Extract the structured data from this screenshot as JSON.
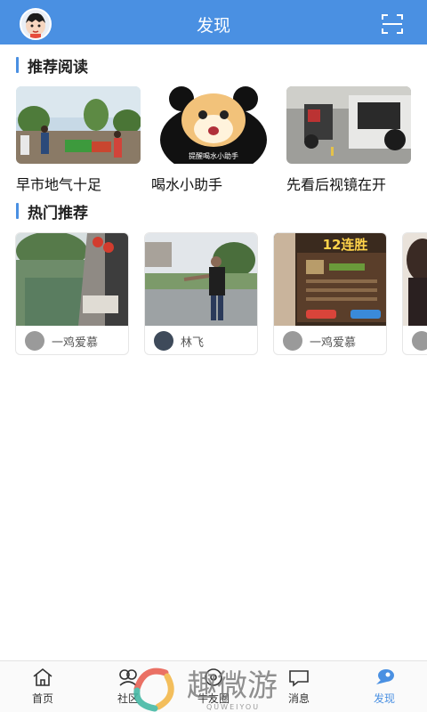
{
  "header": {
    "title": "发现"
  },
  "sections": {
    "recommended": {
      "title": "推荐阅读"
    },
    "hot": {
      "title": "热门推荐"
    }
  },
  "recommended_items": [
    {
      "caption": "早市地气十足"
    },
    {
      "caption": "喝水小助手",
      "image_text": "提醒喝水小助手"
    },
    {
      "caption": "先看后视镜在开"
    }
  ],
  "hot_items": [
    {
      "user": "一鸡爱慕"
    },
    {
      "user": "林飞"
    },
    {
      "user": "一鸡爱慕",
      "image_text": "12连胜"
    }
  ],
  "nav": {
    "items": [
      {
        "label": "首页",
        "icon": "home-icon"
      },
      {
        "label": "社区",
        "icon": "community-icon"
      },
      {
        "label": "牛友圈",
        "icon": "friends-circle-icon"
      },
      {
        "label": "消息",
        "icon": "message-icon"
      },
      {
        "label": "发现",
        "icon": "discover-icon",
        "active": true
      }
    ]
  },
  "watermark": {
    "text": "趣微游",
    "sub": "QUWEIYOU"
  },
  "colors": {
    "accent": "#4a90e2"
  }
}
